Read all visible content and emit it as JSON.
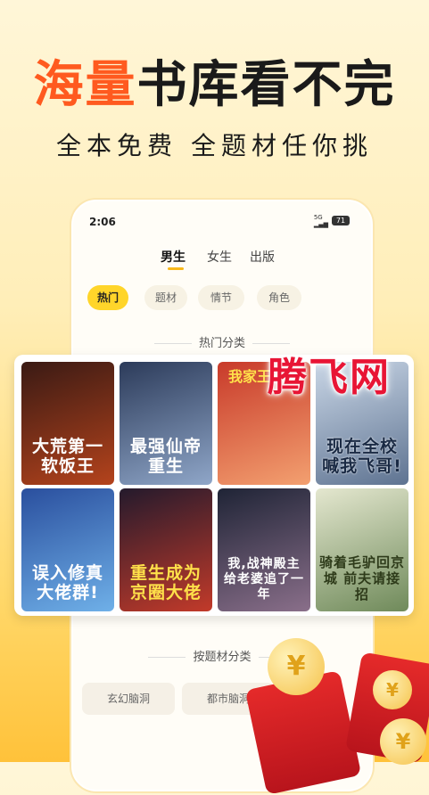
{
  "headline": {
    "accent": "海量",
    "rest": "书库看不完"
  },
  "subline": "全本免费 全题材任你挑",
  "phone": {
    "status": {
      "time": "2:06",
      "signal": "5G",
      "battery": "71"
    },
    "gender_tabs": [
      {
        "label": "男生",
        "active": true
      },
      {
        "label": "女生",
        "active": false
      },
      {
        "label": "出版",
        "active": false
      }
    ],
    "filter_pills": [
      {
        "label": "热门",
        "active": true
      },
      {
        "label": "题材",
        "active": false
      },
      {
        "label": "情节",
        "active": false
      },
      {
        "label": "角色",
        "active": false
      }
    ],
    "hot_section_title": "热门分类",
    "theme_section_title": "按题材分类",
    "theme_categories": [
      "玄幻脑洞",
      "都市脑洞"
    ]
  },
  "covers": [
    {
      "title": "大荒第一软饭王",
      "top": "",
      "colors": [
        "#3a1a14",
        "#b4431c"
      ]
    },
    {
      "title": "最强仙帝重生",
      "top": "",
      "colors": [
        "#2c3b5a",
        "#8fa6c8"
      ]
    },
    {
      "title": "",
      "top": "我家王爷渣",
      "colors": [
        "#c83a2a",
        "#f3a070"
      ]
    },
    {
      "title": "现在全校喊我飞哥!",
      "top": "",
      "colors": [
        "#c9d6e6",
        "#5e7391"
      ]
    },
    {
      "title": "误入修真大佬群!",
      "top": "",
      "colors": [
        "#2a4f9e",
        "#6fb0e8"
      ]
    },
    {
      "title": "重生成为京圈大佬",
      "top": "",
      "colors": [
        "#241a2c",
        "#c23a2a"
      ]
    },
    {
      "title": "我,战神殿主给老婆追了一年",
      "top": "",
      "colors": [
        "#1f2436",
        "#8a6f8a"
      ]
    },
    {
      "title": "骑着毛驴回京城 前夫请接招",
      "top": "",
      "colors": [
        "#e4e7cf",
        "#6f8a5a"
      ]
    }
  ],
  "watermark": "腾飞网",
  "decor": {
    "coin_symbol": "¥"
  },
  "colors": {
    "accent": "#ff5a1f",
    "tab_highlight": "#ffd52a",
    "envelope": "#e52a2a",
    "coin": "#f5c24a"
  }
}
